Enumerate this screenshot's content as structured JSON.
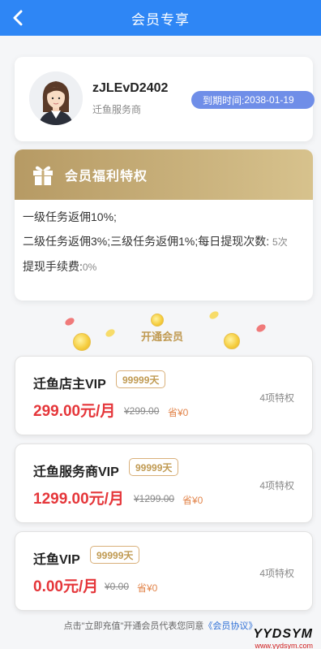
{
  "header": {
    "title": "会员专享",
    "back_icon": "chevron-left-icon"
  },
  "profile": {
    "username": "zJLEvD2402",
    "role": "迁鱼服务商",
    "expire_label": "到期时间:",
    "expire_date": "2038-01-19"
  },
  "welfare": {
    "title": "会员福利特权",
    "icon": "gift-icon",
    "line1": "一级任务返佣10%;",
    "line2_text": "二级任务返佣3%;三级任务返佣1%;每日提现次数:",
    "line2_value": "5次",
    "line3_text": "提现手续费:",
    "line3_value": "0%"
  },
  "open_vip": {
    "label": "开通会员"
  },
  "plans": [
    {
      "name": "迁鱼店主VIP",
      "days": "99999天",
      "price": "299.00元/月",
      "original": "¥299.00",
      "save": "省¥0",
      "perks": "4项特权"
    },
    {
      "name": "迁鱼服务商VIP",
      "days": "99999天",
      "price": "1299.00元/月",
      "original": "¥1299.00",
      "save": "省¥0",
      "perks": "4项特权"
    },
    {
      "name": "迁鱼VIP",
      "days": "99999天",
      "price": "0.00元/月",
      "original": "¥0.00",
      "save": "省¥0",
      "perks": "4项特权"
    }
  ],
  "footer": {
    "text": "点击\"立即充值\"开通会员代表您同意",
    "link": "《会员协议》"
  },
  "watermark": {
    "brand": "YYDSYM",
    "url": "www.yydsym.com"
  },
  "colors": {
    "primary": "#2e86f5",
    "gold": "#c09a52",
    "price": "#e5363a",
    "expire_badge": "#6f8ee8"
  }
}
